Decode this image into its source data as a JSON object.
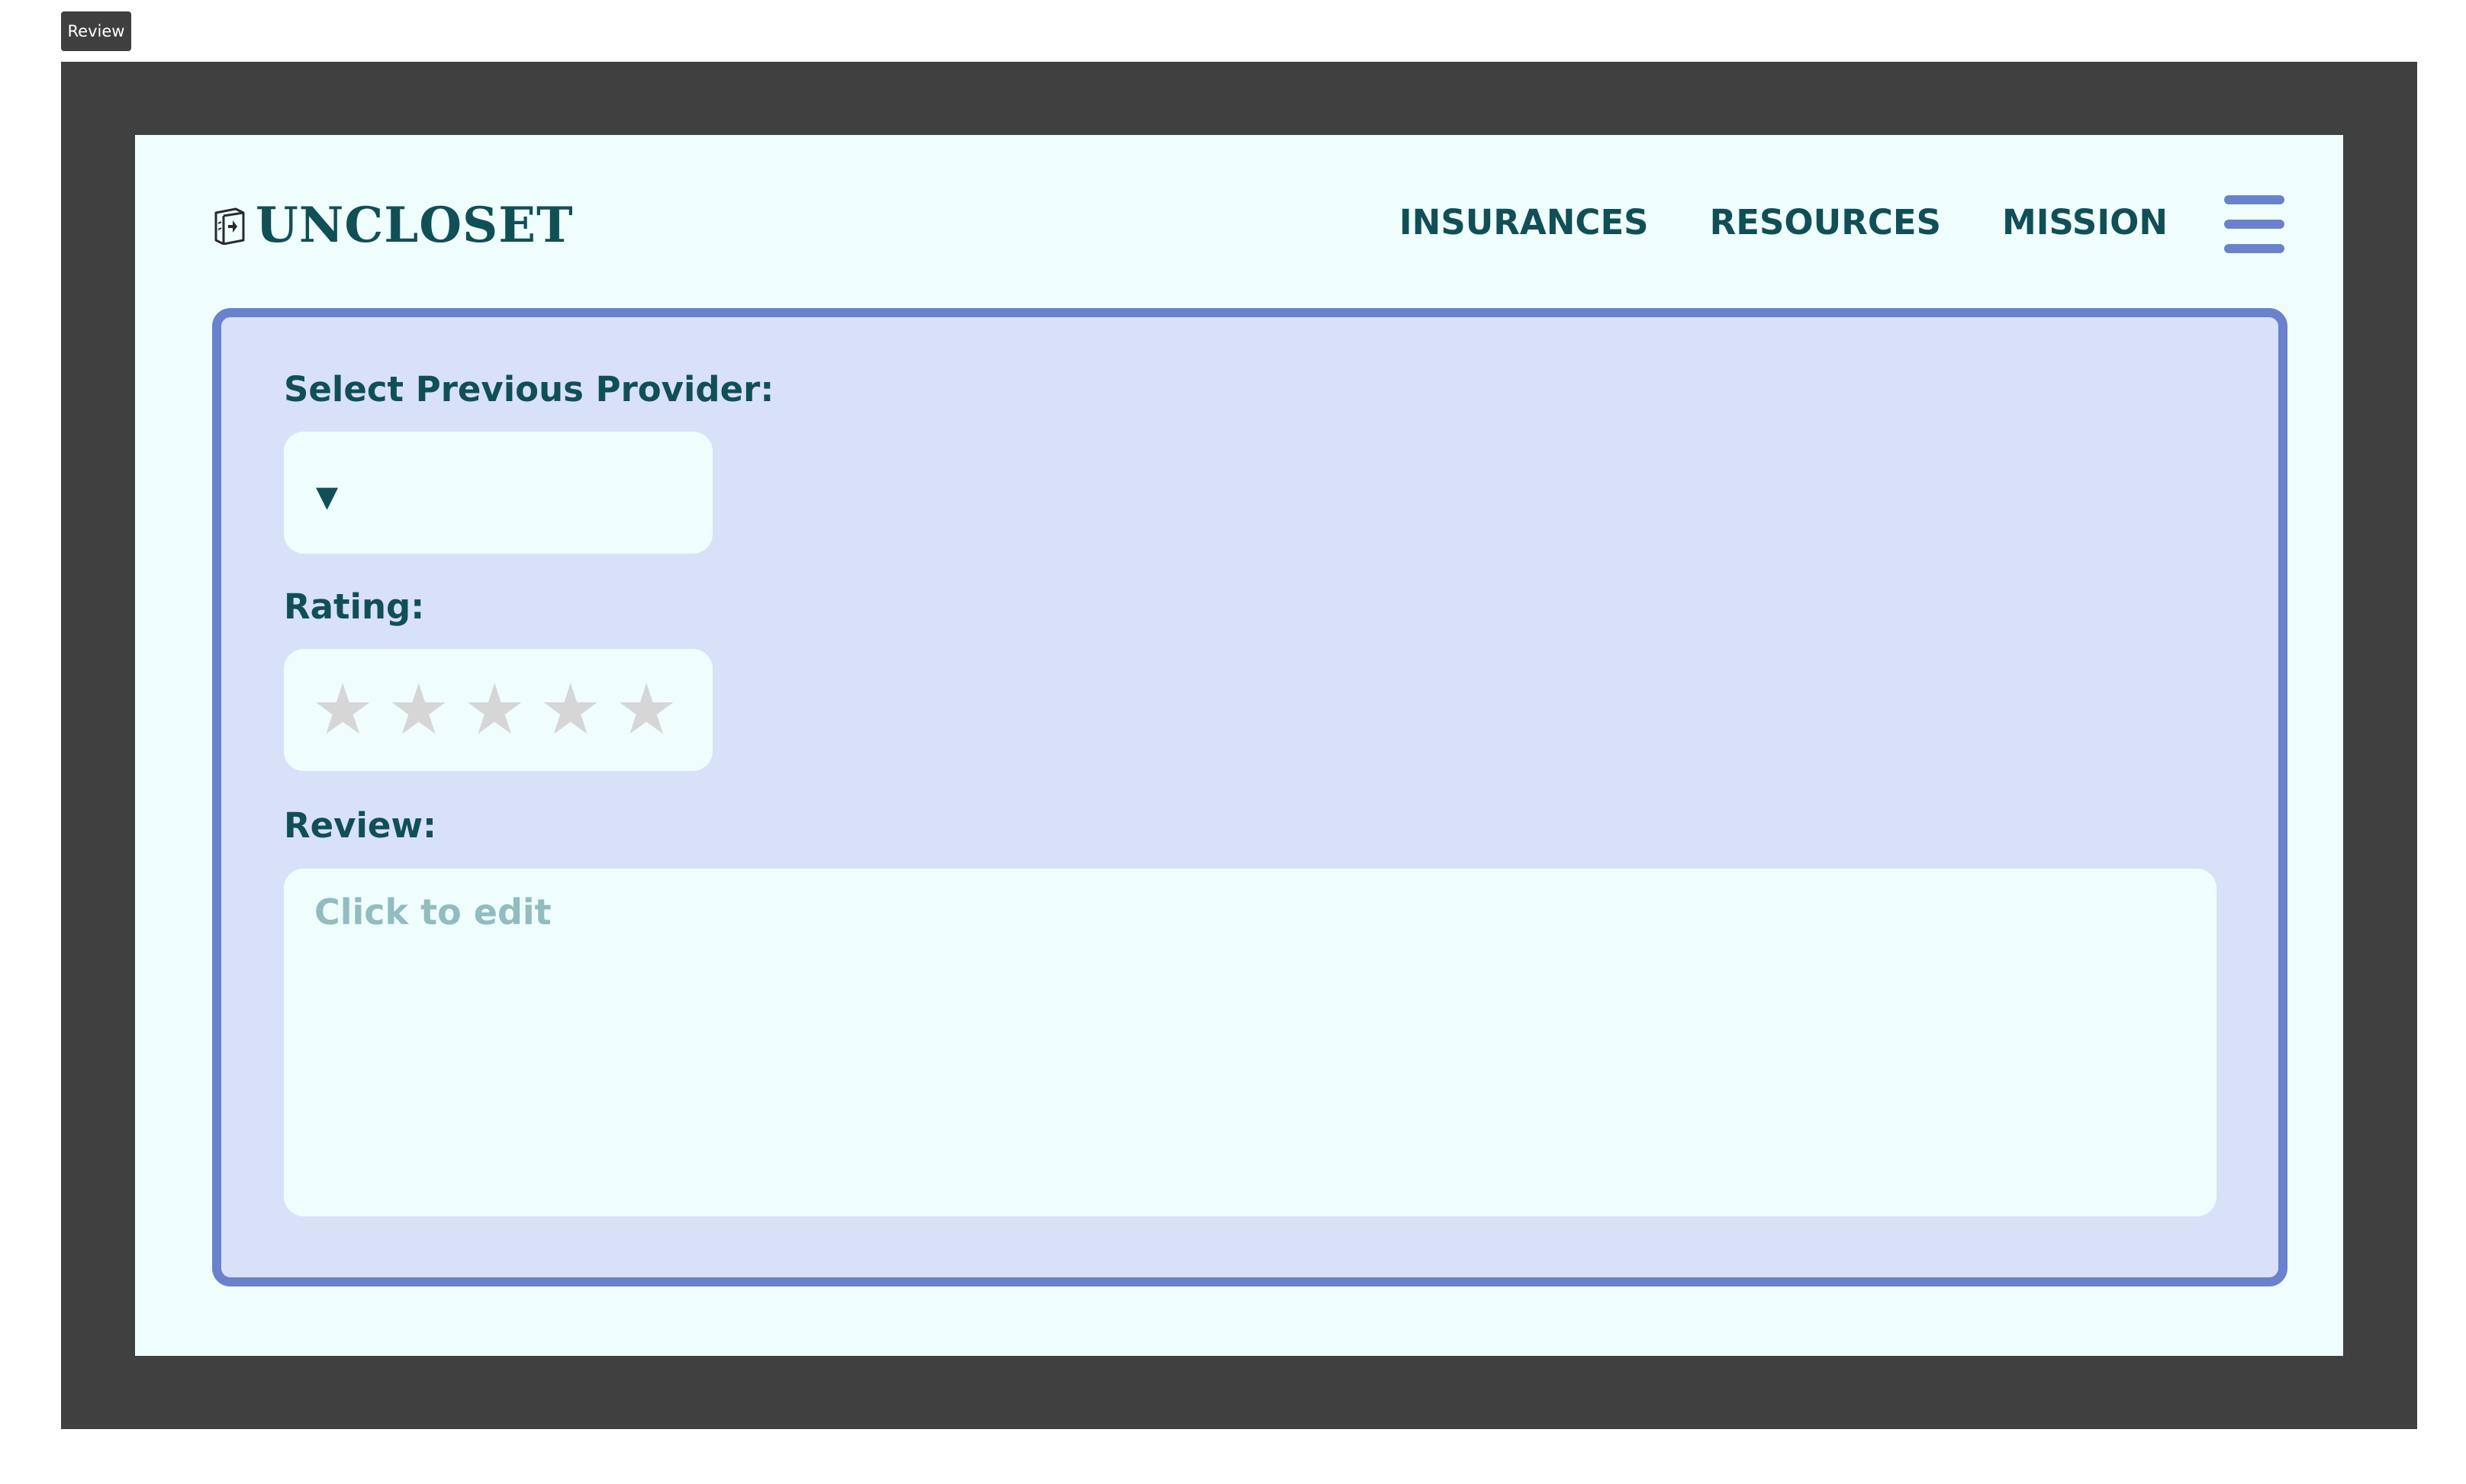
{
  "frame_tag": {
    "label": "Review"
  },
  "header": {
    "logo_text": "UNCLOSET",
    "nav": [
      {
        "label": "INSURANCES"
      },
      {
        "label": "RESOURCES"
      },
      {
        "label": "MISSION"
      }
    ],
    "menu_icon": "hamburger-menu-icon"
  },
  "form": {
    "provider": {
      "label": "Select Previous Provider:",
      "selected_value": "",
      "arrow_glyph": "▼"
    },
    "rating": {
      "label": "Rating:",
      "max": 5,
      "value": 0,
      "star_glyph": "★"
    },
    "review": {
      "label": "Review:",
      "placeholder": "Click to edit",
      "value": ""
    }
  },
  "colors": {
    "brand_dark": "#114f57",
    "accent": "#6a82cc",
    "card_background": "#d8e1f8",
    "screen_background": "#effefd",
    "frame": "#404040",
    "star_empty": "#d6d6d6",
    "placeholder": "#92bcbf"
  }
}
